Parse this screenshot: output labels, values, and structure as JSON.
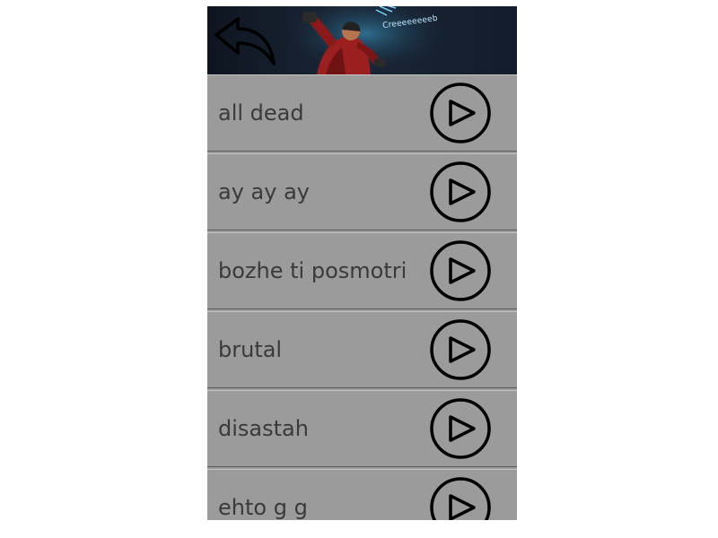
{
  "header": {
    "back_icon": "back-arrow-icon",
    "banner_caption": "Creeeeeeeeb"
  },
  "sounds": [
    {
      "label": "all dead"
    },
    {
      "label": "ay ay ay"
    },
    {
      "label": "bozhe ti posmotri"
    },
    {
      "label": "brutal"
    },
    {
      "label": "disastah"
    },
    {
      "label": "ehto g g"
    }
  ],
  "play_icon": "play-icon",
  "colors": {
    "row_background": "#9b9b9b",
    "text": "#3a3a3a",
    "header_background": "#131c2a"
  }
}
